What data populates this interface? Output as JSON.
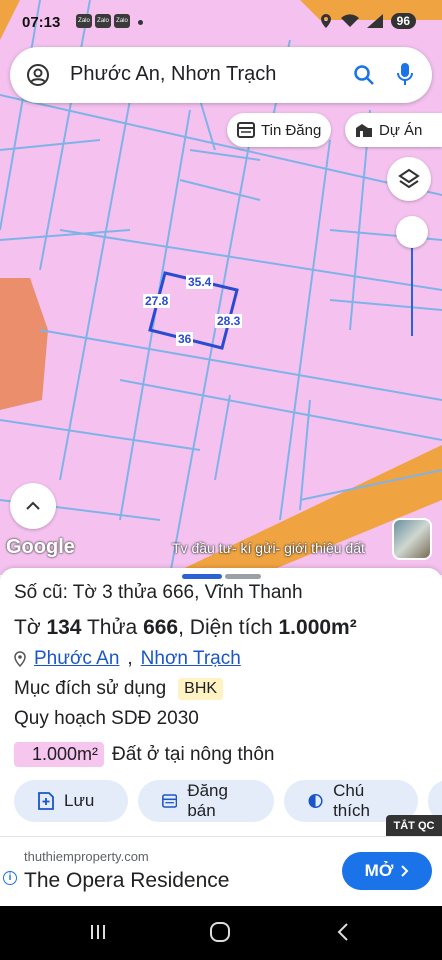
{
  "status_bar": {
    "time": "07:13",
    "app_icons": [
      "Zalo",
      "Zalo",
      "Zalo"
    ],
    "battery": "96"
  },
  "search": {
    "query": "Phước An, Nhơn Trạch"
  },
  "map_chips": {
    "listing": "Tin Đăng",
    "project": "Dự Án"
  },
  "parcel_dims": {
    "top": "35.4",
    "left": "27.8",
    "right": "28.3",
    "bottom": "36"
  },
  "map_footer": {
    "google": "Google",
    "watermark": "Tv đầu tư- kí gửi- giới thiệu đất"
  },
  "sheet": {
    "old_parcel": "Số cũ: Tờ 3 thửa 666, Vĩnh Thanh",
    "sheet_label": "Tờ",
    "sheet_no": "134",
    "plot_label": "Thửa",
    "plot_no": "666",
    "area_label": ", Diện tích",
    "area_value": "1.000m²",
    "ward": "Phước An",
    "district": "Nhơn Trạch",
    "purpose_label": "Mục đích sử dụng",
    "purpose_code": "BHK",
    "plan": "Quy hoạch SDĐ 2030",
    "land_area": "1.000m²",
    "land_type": "Đất ở tại nông thôn"
  },
  "actions": {
    "save": "Lưu",
    "post": "Đăng bán",
    "legend": "Chú thích"
  },
  "ad": {
    "close": "TẮT QC",
    "domain": "thuthiemproperty.com",
    "title": "The Opera Residence",
    "cta": "MỞ"
  },
  "colors": {
    "land_pink": "#f5c2f0",
    "road_orange": "#f0a341",
    "accent_blue": "#1a73e8"
  }
}
